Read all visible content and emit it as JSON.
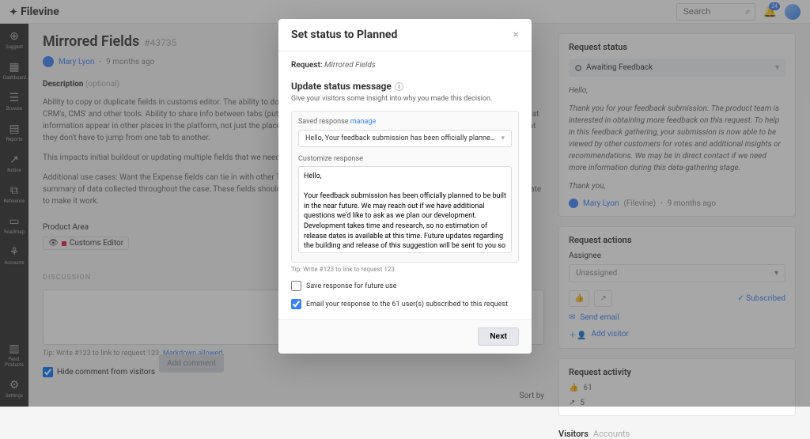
{
  "brand": "Filevine",
  "search": {
    "placeholder": "Search"
  },
  "bell_badge": "24",
  "leftnav": {
    "items": [
      {
        "icon": "⊕",
        "label": "Suggest"
      },
      {
        "icon": "▦",
        "label": "Dashboard"
      },
      {
        "icon": "☰",
        "label": "Browse"
      },
      {
        "icon": "▤",
        "label": "Reports"
      },
      {
        "icon": "↗",
        "label": "Notice"
      },
      {
        "icon": "⧉",
        "label": "Reference"
      },
      {
        "icon": "▭",
        "label": "Roadmap"
      },
      {
        "icon": "⚘",
        "label": "Accounts"
      }
    ],
    "bottom": [
      {
        "icon": "▥",
        "label": "Pend. Products"
      },
      {
        "icon": "⚙",
        "label": "Settings"
      }
    ]
  },
  "page": {
    "title": "Mirrored Fields",
    "id": "#43735",
    "author": "Mary Lyon",
    "time": "9 months ago",
    "desc_label": "Description",
    "desc_optional": "(optional)",
    "desc_p1": "Ability to copy or duplicate fields in customs editor. The ability to do this decreases duplicate work and allows for links/integrations among CRM's, CMS' and other tools. Ability to share info between tabs (put it into intake, have it push into other tabs). We want to be able to have that information appear in other places in the platform, not just the place they put it in to make it so that they can be filling other things out so that they don't have to jump from one tab to another.",
    "desc_p2": "This impacts initial buildout or updating multiple fields that we need to hide/show based on other criteria.",
    "desc_p3": "Additional use cases: Want the Expense fields can tie in with other Tabs with similar Expense fields. We use the Case Summary tab — a summary of data collected throughout the case. These fields should just be referencing other fields but the way it's set up we have to duplicate to make it work.",
    "product_area_label": "Product Area",
    "product_area_tag": "Customs Editor",
    "discussion_label": "DISCUSSION",
    "tip_text": "Tip: Write #123 to link to request 123.",
    "markdown_link": "Markdown allowed.",
    "hide_label": "Hide comment from visitors",
    "add_comment": "Add comment",
    "sort_label": "Sort by"
  },
  "sidebar": {
    "status_title": "Request status",
    "status_value": "Awaiting Feedback",
    "feedback_hello": "Hello,",
    "feedback_body": "Thank you for your feedback submission. The product team is interested in obtaining more feedback on this request. To help in this feedback gathering, your submission is now able to be viewed by other customers for votes and additional insights or recommendations. We may be in direct contact if we need more information during this data-gathering stage.",
    "feedback_thanks": "Thank you,",
    "fb_author": "Mary Lyon",
    "fb_org": "(Filevine)",
    "fb_time": "9 months ago",
    "actions_title": "Request actions",
    "assignee_label": "Assignee",
    "assignee_value": "Unassigned",
    "subscribed": "Subscribed",
    "send_email": "Send email",
    "add_visitor": "Add visitor",
    "activity_title": "Request activity",
    "thumbs": "61",
    "shares": "5",
    "visitors": "Visitors",
    "accounts": "Accounts"
  },
  "modal": {
    "title": "Set status to Planned",
    "request_label": "Request",
    "request_value": "Mirrored Fields",
    "update_title": "Update status message",
    "update_sub": "Give your visitors some insight into why you made this decision.",
    "saved_label": "Saved response",
    "manage": "manage",
    "saved_selected": "Hello, Your feedback submission has been officially planned to be built i...",
    "customize_label": "Customize response",
    "customize_value": "Hello,\n\nYour feedback submission has been officially planned to be built in the near future. We may reach out if we have additional questions we'd like to ask as we plan our development. Development takes time and research, so no estimation of release dates is available at this time. Future updates regarding the building and release of this suggestion will be sent to you so you remain informed of any progress.\n\nThank you,",
    "tip": "Tip: Write #123 to link to request 123.",
    "save_future": "Save response for future use",
    "email_users": "Email your response to the 61 user(s) subscribed to this request",
    "next": "Next"
  }
}
